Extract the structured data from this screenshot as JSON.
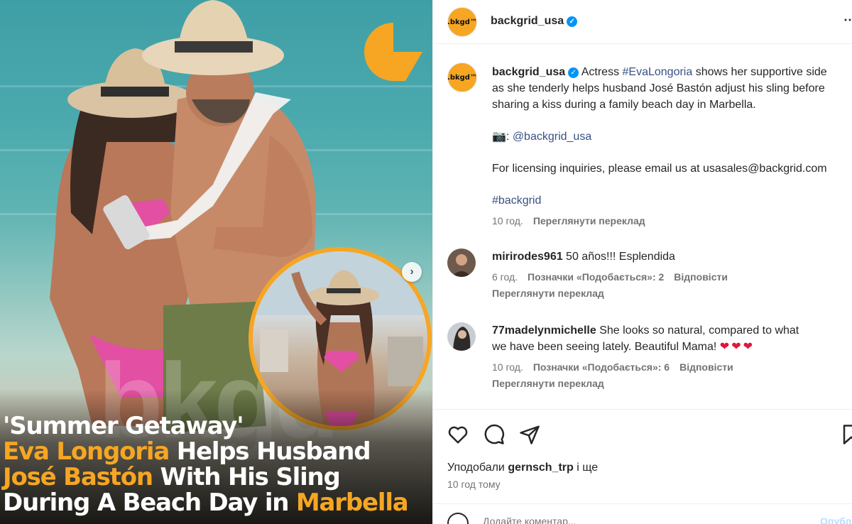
{
  "media": {
    "logo_glyph": "G",
    "watermark": "bkgd",
    "headline": {
      "line1": "'Summer Getaway'",
      "line2_hl": "Eva Longoria",
      "line2_rest": " Helps Husband",
      "line3_hl": "José Bastón",
      "line3_rest": " With His Sling",
      "line4_rest": "During A Beach Day in ",
      "line4_hl": "Marbella"
    },
    "accent_color": "#f6a623",
    "next_icon": "chevron-right-icon"
  },
  "post": {
    "account": "backgrid_usa",
    "avatar_text": ".bkgd™",
    "more_icon": "more-horizontal-icon",
    "caption": {
      "name": "backgrid_usa",
      "text_before": " Actress ",
      "hashtag_eva": "#EvaLongoria",
      "text_line1_after": " shows her supportive side",
      "text_line2": "as she tenderly helps husband José Bastón adjust his sling before",
      "text_line3": "sharing a kiss during a family beach day in Marbella.",
      "camera": "📷: ",
      "credit": "@backgrid_usa",
      "licensing": "For licensing inquiries, please email us at usasales@backgrid.com",
      "hashtag_backgrid": "#backgrid",
      "time": "10 год.",
      "see_translation": "Переглянути переклад"
    },
    "comments": [
      {
        "user": "mirirodes961",
        "text": " 50 años!!! Esplendida",
        "time": "6 год.",
        "likes": "Позначки «Подобається»: 2",
        "reply": "Відповісти",
        "translate": "Переглянути переклад"
      },
      {
        "user": "77madelynmichelle",
        "text_line1": " She looks so natural, compared to what",
        "text_line2": "we have been seeing lately. Beautiful Mama! ",
        "hearts": "❤❤❤",
        "time": "10 год.",
        "likes": "Позначки «Подобається»: 6",
        "reply": "Відповісти",
        "translate": "Переглянути переклад"
      }
    ],
    "liked_by_prefix": "Уподобали ",
    "liked_by_user": "gernsch_trp",
    "liked_by_suffix": " і ще",
    "time_ago": "10 год тому",
    "add_comment_placeholder": "Додайте коментар...",
    "post_button": "Опублікувати"
  }
}
